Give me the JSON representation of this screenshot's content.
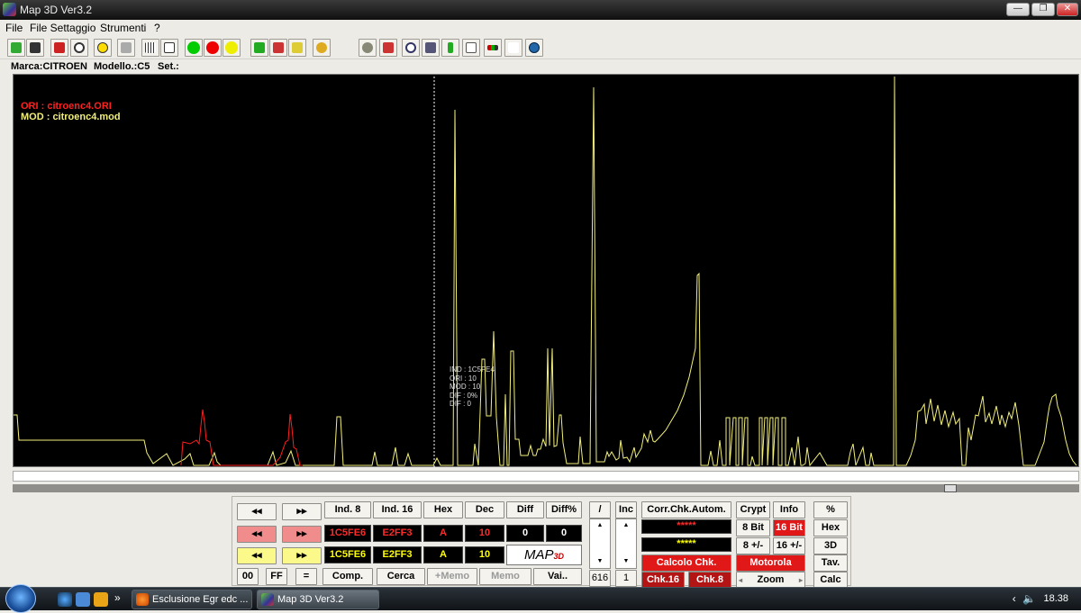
{
  "window": {
    "title": "Map 3D Ver3.2",
    "minimize": "—",
    "maximize": "❐",
    "close": "✕"
  },
  "menu": [
    "File",
    "File Settaggio",
    "Strumenti",
    "?"
  ],
  "toolbar": {
    "icons": [
      "open-file-icon",
      "chip-icon",
      "bookmark-icon",
      "gauge-icon",
      "warning-icon",
      "lock-icon",
      "grid-icon",
      "chart-icon",
      "green-light-icon",
      "red-light-icon",
      "yellow-light-icon",
      "compare-green-icon",
      "compare-red-icon",
      "compare-yellow-icon",
      "checksum-icon",
      "settings-icon",
      "car-icon",
      "magnifier-icon",
      "notes-icon",
      "download-icon",
      "document-icon",
      "battery-icon",
      "function-icon",
      "globe-icon"
    ]
  },
  "info": {
    "marca": "Marca:CITROEN",
    "modello": "Modello.:C5",
    "set": "Set.:"
  },
  "graph": {
    "legend_ori": "ORI  : citroenc4.ORI",
    "legend_mod": "MOD : citroenc4.mod",
    "tooltip": [
      "IND : 1C5FE4",
      "ORI : 10",
      "MOD : 10",
      "DIF : 0%",
      "DIF : 0"
    ],
    "colors": {
      "ori": "#ff1f1f",
      "mod": "#f3f07a",
      "cursor": "#ffffff"
    }
  },
  "panel": {
    "nav": {
      "prev": "◂◂",
      "next": "▸▸"
    },
    "headers": [
      "Ind. 8",
      "Ind. 16",
      "Hex",
      "Dec",
      "Diff",
      "Diff%"
    ],
    "ori_row": [
      "1C5FE6",
      "E2FF3",
      "A",
      "10",
      "0",
      "0"
    ],
    "mod_row": [
      "1C5FE6",
      "E2FF3",
      "A",
      "10"
    ],
    "logo": "MAP",
    "logo_sub": "3D",
    "bottom": [
      "00",
      "FF",
      "=",
      "Comp.",
      "Cerca",
      "+Memo",
      "Memo",
      "Vai.."
    ],
    "slash": "/",
    "inc": "Inc",
    "spin_value_left": "616",
    "spin_value_right": "1",
    "corr": "Corr.Chk.Autom.",
    "star1": "*****",
    "star2": "*****",
    "calcolo": "Calcolo Chk.",
    "chk16": "Chk.16",
    "chk8": "Chk.8",
    "crypt": "Crypt",
    "info": "Info",
    "bit8": "8 Bit",
    "bit16": "16 Bit",
    "pm8": "8 +/-",
    "pm16": "16 +/-",
    "motorola": "Motorola",
    "zoom": "Zoom",
    "right": [
      "%",
      "Hex",
      "3D",
      "Tav.",
      "Calc"
    ]
  },
  "taskbar": {
    "tasks": [
      "Esclusione Egr edc ...",
      "Map 3D Ver3.2"
    ],
    "chevron": "»",
    "tray_arrow": "‹",
    "volume": "🔈",
    "clock": "18.38"
  }
}
